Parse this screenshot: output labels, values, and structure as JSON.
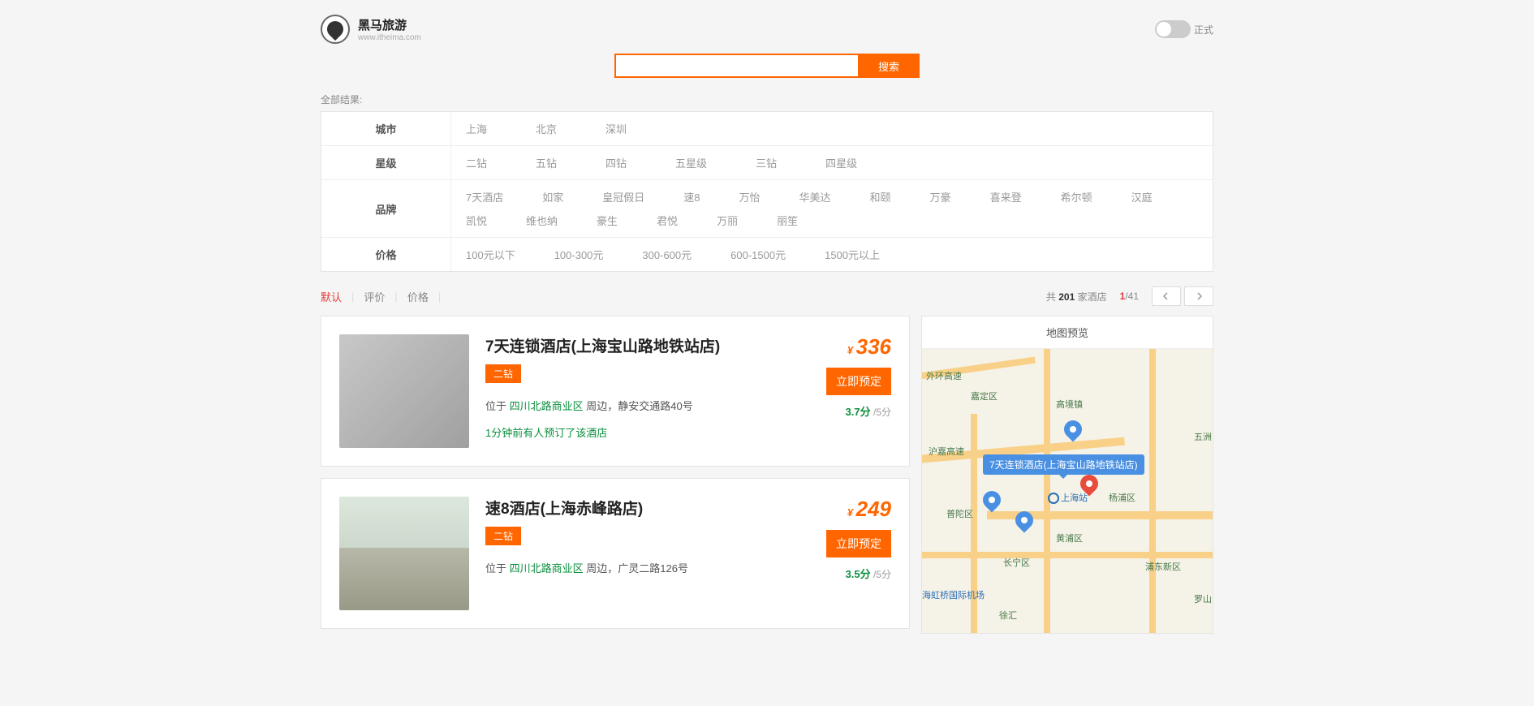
{
  "header": {
    "logo_title": "黑马旅游",
    "logo_sub": "www.itheima.com",
    "toggle_label": "正式"
  },
  "search": {
    "value": "",
    "button": "搜索"
  },
  "filters": {
    "all_label": "全部结果:",
    "city_head": "城市",
    "cities": [
      "上海",
      "北京",
      "深圳"
    ],
    "star_head": "星级",
    "stars": [
      "二钻",
      "五钻",
      "四钻",
      "五星级",
      "三钻",
      "四星级"
    ],
    "brand_head": "品牌",
    "brands_row1": [
      "7天酒店",
      "如家",
      "皇冠假日",
      "速8",
      "万怡",
      "华美达",
      "和颐",
      "万豪",
      "喜来登",
      "希尔顿",
      "汉庭"
    ],
    "brands_row2": [
      "凯悦",
      "维也纳",
      "豪生",
      "君悦",
      "万丽",
      "丽笙"
    ],
    "price_head": "价格",
    "prices": [
      "100元以下",
      "100-300元",
      "300-600元",
      "600-1500元",
      "1500元以上"
    ]
  },
  "sort": {
    "tab_default": "默认",
    "tab_review": "评价",
    "tab_price": "价格",
    "count_prefix": "共 ",
    "count_num": "201",
    "count_suffix": " 家酒店",
    "page_current": "1",
    "page_total": "/41"
  },
  "hotels": [
    {
      "name": "7天连锁酒店(上海宝山路地铁站店)",
      "star": "二钻",
      "loc_prefix": "位于 ",
      "area": "四川北路商业区",
      "loc_suffix": " 周边，静安交通路40号",
      "note": "1分钟前有人预订了该酒店",
      "price": "336",
      "book": "立即预定",
      "rating_score": "3.7分",
      "rating_total": " /5分"
    },
    {
      "name": "速8酒店(上海赤峰路店)",
      "star": "二钻",
      "loc_prefix": "位于 ",
      "area": "四川北路商业区",
      "loc_suffix": " 周边，广灵二路126号",
      "note": "",
      "price": "249",
      "book": "立即预定",
      "rating_score": "3.5分",
      "rating_total": " /5分"
    }
  ],
  "map": {
    "title": "地图预览",
    "tooltip": "7天连锁酒店(上海宝山路地铁站店)",
    "station": "上海站",
    "labels": {
      "l1": "外环高速",
      "l2": "沪嘉高速",
      "l3": "普陀区",
      "l4": "长宁区",
      "l5": "海虹桥国际机场",
      "l6": "嘉定区",
      "l7": "高境镇",
      "l8": "杨浦区",
      "l9": "黄浦区",
      "l10": "浦东新区",
      "l11": "徐汇",
      "l12": "五洲",
      "l13": "罗山"
    }
  }
}
